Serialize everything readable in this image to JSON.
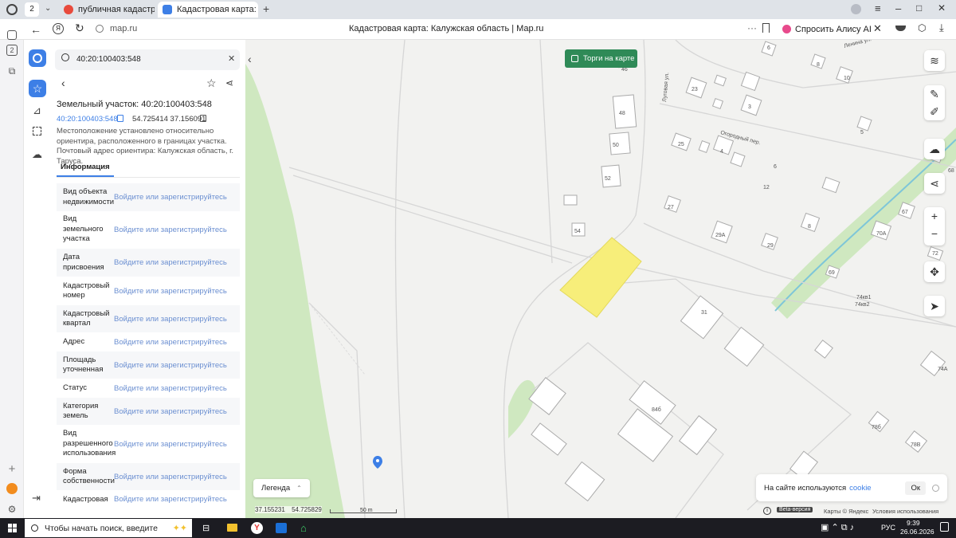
{
  "browser": {
    "tab_count": "2",
    "tabs": [
      {
        "label": "публичная кадастровая к",
        "active": false
      },
      {
        "label": "Кадастровая карта: Ка",
        "active": true
      }
    ],
    "url": "map.ru",
    "page_title": "Кадастровая карта: Калужская область | Map.ru",
    "alice_label": "Спросить Алису AI"
  },
  "panel": {
    "search_value": "40:20:100403:548",
    "title": "Земельный участок: 40:20:100403:548",
    "cadnum": "40:20:100403:548",
    "coords": "54.725414 37.156091",
    "description": "Местоположение установлено относительно ориентира, расположенного в границах участка. Почтовый адрес ориентира: Калужская область, г. Таруса.",
    "tab_info": "Информация",
    "rows": [
      {
        "label": "Вид объекта недвижимости",
        "value": "Войдите или зарегистрируйтесь"
      },
      {
        "label": "Вид земельного участка",
        "value": "Войдите или зарегистрируйтесь"
      },
      {
        "label": "Дата присвоения",
        "value": "Войдите или зарегистрируйтесь"
      },
      {
        "label": "Кадастровый номер",
        "value": "Войдите или зарегистрируйтесь"
      },
      {
        "label": "Кадастровый квартал",
        "value": "Войдите или зарегистрируйтесь"
      },
      {
        "label": "Адрес",
        "value": "Войдите или зарегистрируйтесь"
      },
      {
        "label": "Площадь уточненная",
        "value": "Войдите или зарегистрируйтесь"
      },
      {
        "label": "Статус",
        "value": "Войдите или зарегистрируйтесь"
      },
      {
        "label": "Категория земель",
        "value": "Войдите или зарегистрируйтесь"
      },
      {
        "label": "Вид разрешенного использования",
        "value": "Войдите или зарегистрируйтесь"
      },
      {
        "label": "Форма собственности",
        "value": "Войдите или зарегистрируйтесь"
      },
      {
        "label": "Кадастровая",
        "value": "Войдите или зарегистрируйтесь"
      }
    ]
  },
  "map": {
    "torgi_label": "Торги на карте",
    "legend_label": "Легенда",
    "cursor_lon": "37.155231",
    "cursor_lat": "54.725829",
    "scale_label": "50 m",
    "beta_label": "Beta-версия",
    "attribution": "Карты © Яндекс",
    "terms": "Условия использования",
    "cookie_text": "На сайте используются",
    "cookie_link": "cookie",
    "cookie_ok": "Ок",
    "street_labels": [
      "Луговая ул.",
      "Огородный пер.",
      "Ленина ул."
    ],
    "house_labels": [
      "6",
      "8",
      "10",
      "46",
      "23",
      "3",
      "48",
      "5",
      "50",
      "25",
      "4",
      "6",
      "52",
      "12",
      "27",
      "54",
      "8",
      "29А",
      "29",
      "67",
      "70А",
      "72",
      "69",
      "74кв1",
      "74кв2",
      "31",
      "84б",
      "78б",
      "78В",
      "74А",
      "68"
    ],
    "colors": {
      "parcel": "#f7ee7a",
      "green_area": "#cfe8c0",
      "torgi_bg": "#2f8a57",
      "pin": "#3d7fe6"
    }
  },
  "taskbar": {
    "search_placeholder": "Чтобы начать поиск, введите",
    "lang": "РУС",
    "time": "9:39",
    "date": "26.06.2026"
  }
}
